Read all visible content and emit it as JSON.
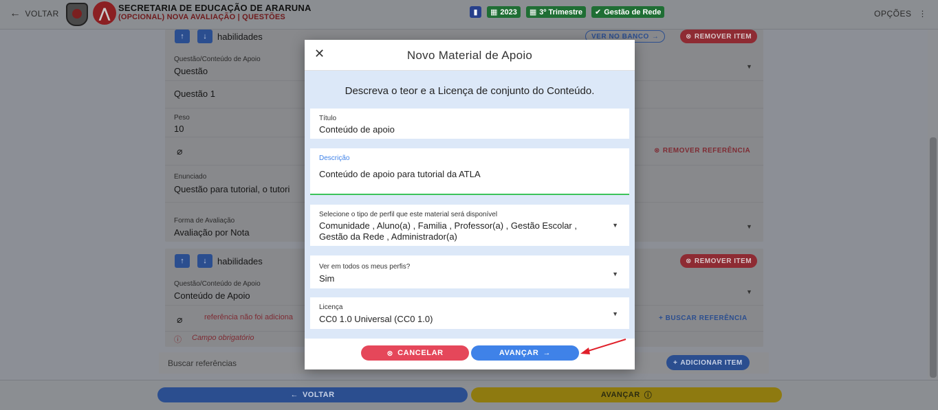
{
  "topbar": {
    "back_label": "VOLTAR",
    "org_title": "SECRETARIA DE EDUCAÇÃO DE ARARUNA",
    "org_subtitle": "(OPCIONAL) NOVA AVALIAÇÃO | QUESTÕES",
    "chips": {
      "year": "2023",
      "term": "3º Trimestre",
      "scope": "Gestão de Rede"
    },
    "options_label": "OPÇÕES"
  },
  "item1": {
    "habilidades": "habilidades",
    "ver_no_banco": "VER NO BANCO",
    "remover_item": "REMOVER ITEM",
    "questao_label": "Questão/Conteúdo de Apoio",
    "questao_value": "Questão",
    "questao_name": "Questão 1",
    "peso_label": "Peso",
    "peso_value": "10",
    "remover_referencia": "REMOVER REFERÊNCIA",
    "enunciado_label": "Enunciado",
    "enunciado_value": "Questão para tutorial, o tutori",
    "forma_label": "Forma de Avaliação",
    "forma_value": "Avaliação por Nota"
  },
  "item2": {
    "habilidades": "habilidades",
    "remover_item": "REMOVER ITEM",
    "questao_label": "Questão/Conteúdo de Apoio",
    "questao_value": "Conteúdo de Apoio",
    "ref_warning": "referência não foi adiciona",
    "buscar_referencia": "BUSCAR REFERÊNCIA",
    "campo_obrigatorio": "Campo obrigatório"
  },
  "search": {
    "placeholder": "Buscar referências",
    "add_item": "ADICIONAR ITEM"
  },
  "bottom": {
    "voltar": "VOLTAR",
    "avancar": "AVANÇAR"
  },
  "modal": {
    "title": "Novo Material de Apoio",
    "subtitle": "Descreva o teor e a Licença de conjunto do Conteúdo.",
    "titulo_label": "Título",
    "titulo_value": "Conteúdo de apoio",
    "descricao_label": "Descrição",
    "descricao_value": "Conteúdo de apoio para tutorial da ATLA",
    "perfil_label": "Selecione o tipo de perfil que este material será disponível",
    "perfil_value_line1": "Comunidade , Aluno(a) , Familia , Professor(a) , Gestão Escolar ,",
    "perfil_value_line2": "Gestão da Rede , Administrador(a)",
    "ver_todos_label": "Ver em todos os meus perfis?",
    "ver_todos_value": "Sim",
    "licenca_label": "Licença",
    "licenca_value": "CC0 1.0 Universal (CC0 1.0)",
    "cancelar": "CANCELAR",
    "avancar": "AVANÇAR"
  },
  "colors": {
    "accent_blue": "#3f82e8",
    "cancel_red": "#e5475a",
    "focus_green": "#3cc35a",
    "modal_body": "#dce8f8",
    "annotation_red": "#e0202a"
  }
}
